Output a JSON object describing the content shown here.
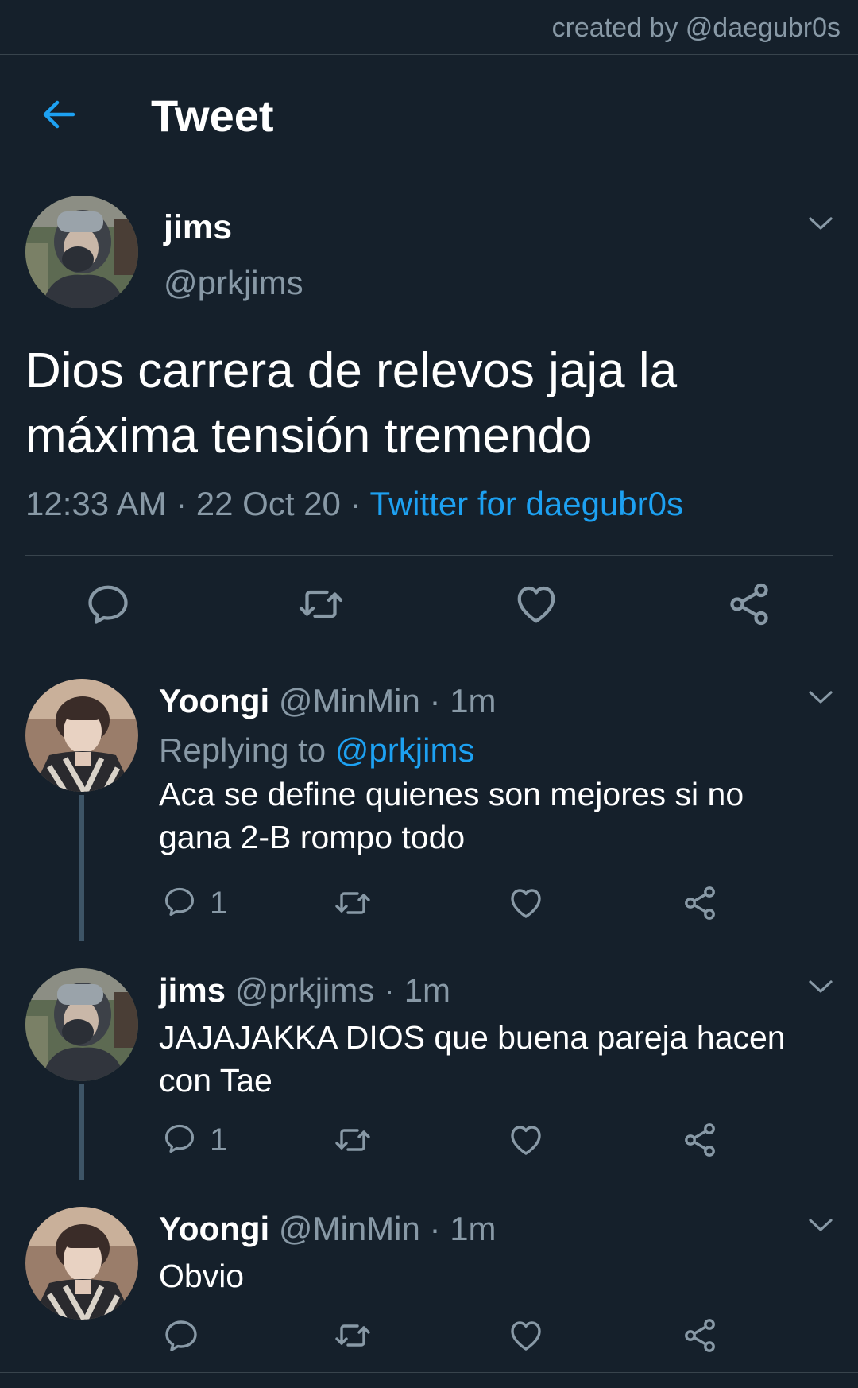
{
  "credit": "created by @daegubr0s",
  "header": {
    "title": "Tweet"
  },
  "main_tweet": {
    "name": "jims",
    "handle": "@prkjims",
    "text_line1": "Dios carrera de relevos jaja la",
    "text_line2": "máxima tensión tremendo",
    "time": "12:33 AM",
    "sep1": " · ",
    "date": "22 Oct 20",
    "sep2": " · ",
    "source": "Twitter for daegubr0s"
  },
  "replies": [
    {
      "name": "Yoongi",
      "handle": "@MinMin",
      "dot": " · ",
      "time": "1m",
      "replying_label": "Replying to ",
      "replying_to": "@prkjims",
      "text_line1": "Aca se define quienes son mejores si no",
      "text_line2": "gana 2-B rompo todo",
      "reply_count": "1"
    },
    {
      "name": "jims",
      "handle": "@prkjims",
      "dot": " · ",
      "time": "1m",
      "text_line1": "JAJAJAKKA DIOS que buena pareja hacen",
      "text_line2": "con Tae",
      "reply_count": "1"
    },
    {
      "name": "Yoongi",
      "handle": "@MinMin",
      "dot": " · ",
      "time": "1m",
      "text_line1": "Obvio"
    }
  ],
  "colors": {
    "background": "#15202b",
    "accent": "#1da1f2",
    "muted": "#8899a6",
    "divider": "#38444d"
  },
  "icons": [
    "back-arrow-icon",
    "chevron-down-icon",
    "reply-icon",
    "retweet-icon",
    "like-icon",
    "share-icon"
  ]
}
